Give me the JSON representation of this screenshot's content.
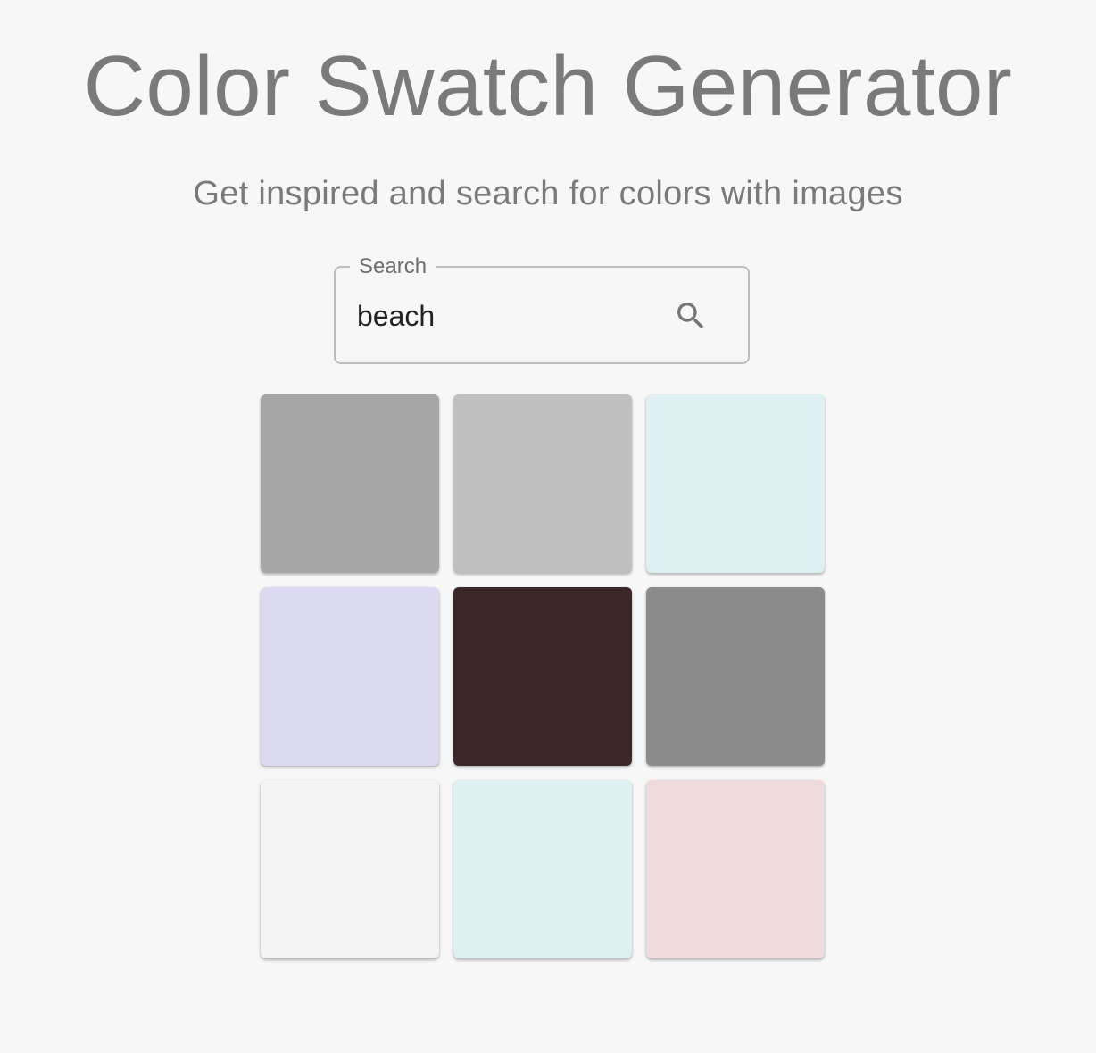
{
  "header": {
    "title": "Color Swatch Generator",
    "subtitle": "Get inspired and search for colors with images"
  },
  "search": {
    "label": "Search",
    "value": "beach",
    "icon": "search-icon"
  },
  "swatches": [
    {
      "color": "#a6a6a6"
    },
    {
      "color": "#c0c0c0"
    },
    {
      "color": "#dff0f3"
    },
    {
      "color": "#dbdaf0"
    },
    {
      "color": "#3c2728"
    },
    {
      "color": "#8b8b8b"
    },
    {
      "color": "#f3f3f3"
    },
    {
      "color": "#dff0f3"
    },
    {
      "color": "#efdbdb"
    }
  ]
}
